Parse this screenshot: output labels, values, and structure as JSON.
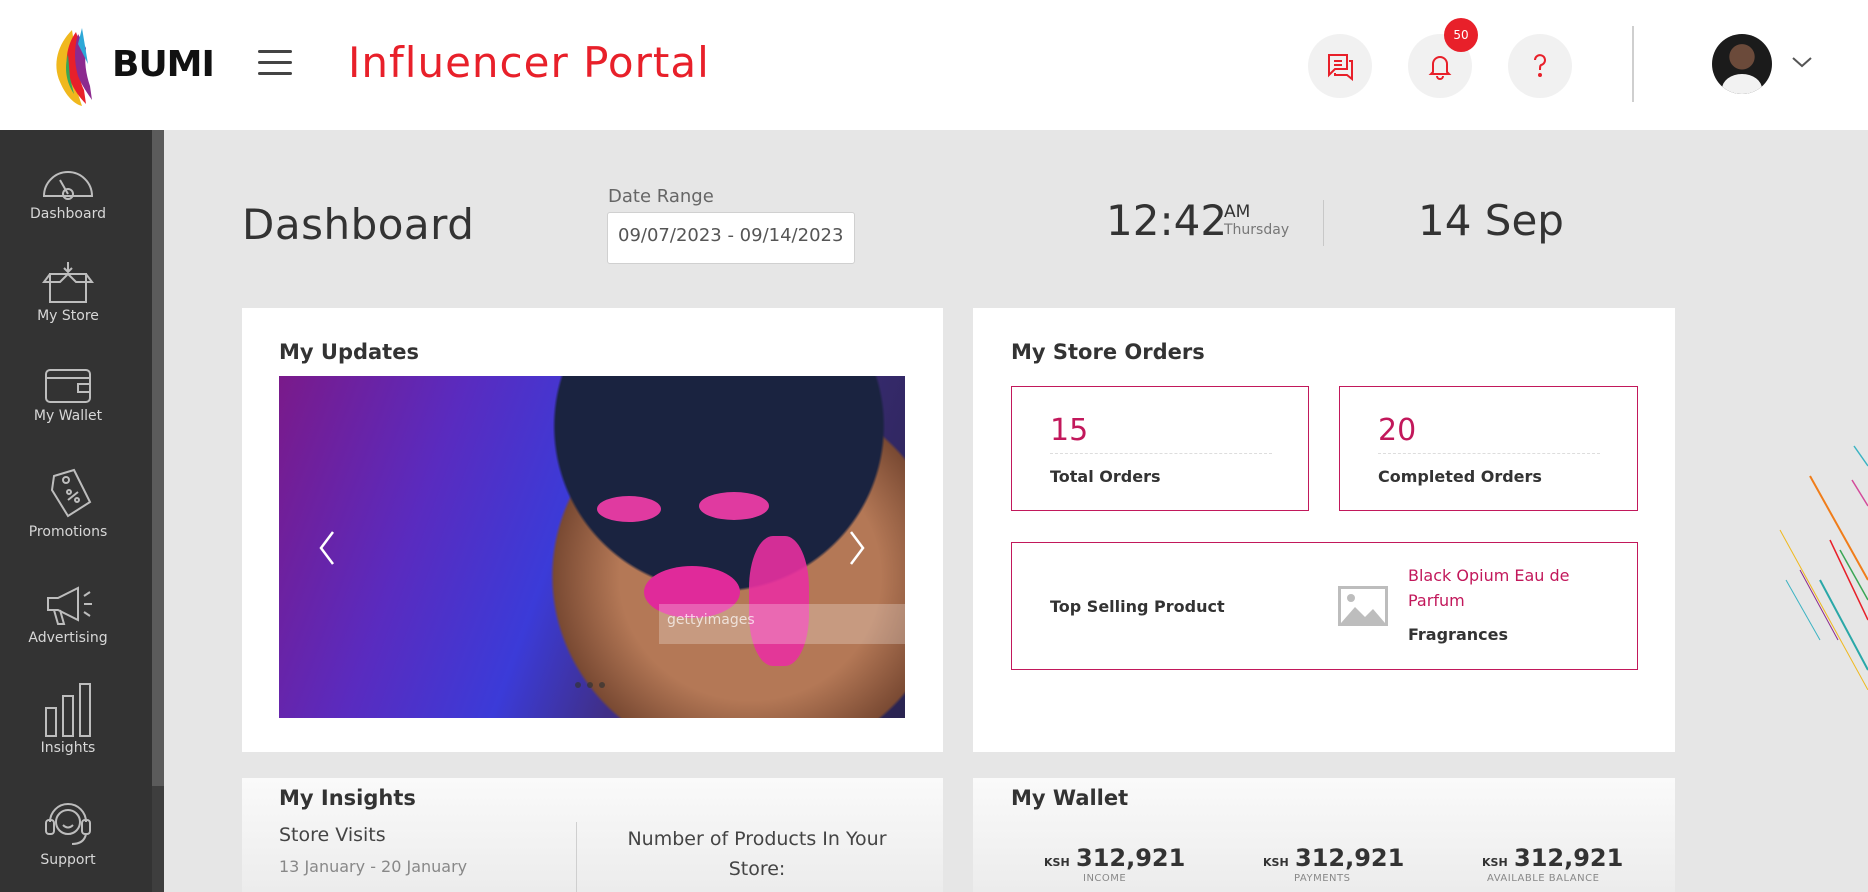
{
  "header": {
    "logo_text": "BUMI",
    "portal_title": "Influencer Portal",
    "notification_count": "50"
  },
  "sidebar": {
    "items": [
      {
        "label": "Dashboard",
        "icon": "gauge-icon"
      },
      {
        "label": "My Store",
        "icon": "box-icon"
      },
      {
        "label": "My Wallet",
        "icon": "wallet-icon"
      },
      {
        "label": "Promotions",
        "icon": "tag-icon"
      },
      {
        "label": "Advertising",
        "icon": "megaphone-icon"
      },
      {
        "label": "Insights",
        "icon": "bar-chart-icon"
      },
      {
        "label": "Support",
        "icon": "headset-icon"
      }
    ]
  },
  "dashboard": {
    "title": "Dashboard",
    "date_range_label": "Date Range",
    "date_range_value": "09/07/2023 - 09/14/2023",
    "time": "12:42",
    "ampm": "AM",
    "weekday": "Thursday",
    "date": "14 Sep"
  },
  "updates": {
    "title": "My Updates",
    "watermark": "gettyimages",
    "dots": 3
  },
  "store_orders": {
    "title": "My Store Orders",
    "total_orders_value": "15",
    "total_orders_label": "Total Orders",
    "completed_orders_value": "20",
    "completed_orders_label": "Completed Orders",
    "top_selling_label": "Top Selling Product",
    "top_product_name": "Black Opium Eau de Parfum",
    "top_product_category": "Fragrances"
  },
  "insights": {
    "title": "My Insights",
    "store_visits_label": "Store Visits",
    "store_visits_range": "13 January - 20 January",
    "products_label": "Number of Products In Your Store:"
  },
  "wallet": {
    "title": "My Wallet",
    "currency": "KSH",
    "items": [
      {
        "amount": "312,921",
        "label": "INCOME"
      },
      {
        "amount": "312,921",
        "label": "PAYMENTS"
      },
      {
        "amount": "312,921",
        "label": "AVAILABLE BALANCE"
      }
    ]
  },
  "colors": {
    "brand_red": "#e8202a",
    "accent_magenta": "#c2185b",
    "sidebar_bg": "#333333"
  }
}
